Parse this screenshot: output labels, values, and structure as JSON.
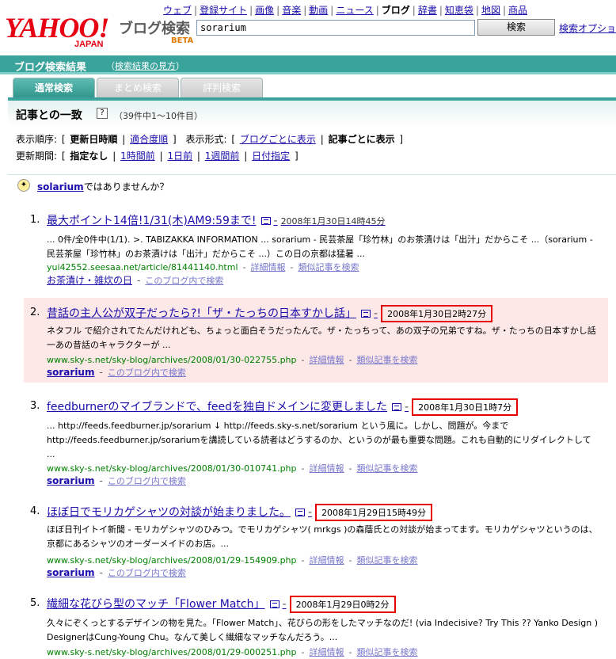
{
  "nav": {
    "items": [
      "ウェブ",
      "登録サイト",
      "画像",
      "音楽",
      "動画",
      "ニュース",
      "ブログ",
      "辞書",
      "知恵袋",
      "地図",
      "商品"
    ],
    "current": "ブログ"
  },
  "header": {
    "logo_main": "YAHOO!",
    "logo_sub": "JAPAN",
    "service": "ブログ検索",
    "beta": "BETA",
    "search_value": "sorarium",
    "search_button": "検索",
    "search_options": "検索オプション"
  },
  "result_bar": {
    "title": "ブログ検索結果",
    "help": "（検索結果の見方）",
    "help_link": "検索結果の見方"
  },
  "tabs": [
    {
      "label": "通常検索",
      "active": true
    },
    {
      "label": "まとめ検索",
      "active": false
    },
    {
      "label": "評判検索",
      "active": false
    }
  ],
  "section": {
    "title": "記事との一致",
    "help_icon": "?",
    "count": "（39件中1～10件目）"
  },
  "sort": {
    "label": "表示順序:",
    "open": "[",
    "option1": "更新日時順",
    "option2": "適合度順",
    "close": "]",
    "display_label": "表示形式:",
    "display1": "ブログごとに表示",
    "display2": "記事ごとに表示"
  },
  "period": {
    "label": "更新期間:",
    "open": "[",
    "opt0": "指定なし",
    "opt1": "1時間前",
    "opt2": "1日前",
    "opt3": "1週間前",
    "opt4": "日付指定",
    "close": "]"
  },
  "suggest": {
    "word": "solarium",
    "text": "ではありませんか？"
  },
  "results": [
    {
      "num": "1.",
      "title": "最大ポイント14倍!1/31(木)AM9:59まで!",
      "date": "2008年1月30日14時45分",
      "date_boxed": false,
      "snippet": "... 0件/全0件中(1/1). >. TABIZAKKA INFORMATION ... sorarium - 民芸茶屋「珍竹林」のお茶漬けは「出汁」だからこそ ...（sorarium - 民芸茶屋「珍竹林」のお茶漬けは「出汁」だからこそ ...）この日の京都は猛暑 ...",
      "url": "yui42552.seesaa.net/article/81441140.html",
      "detail": "詳細情報",
      "similar": "類似記事を検索",
      "blog": "お茶漬け・雑炊の日",
      "blog_search": "このブログ内で検索"
    },
    {
      "num": "2.",
      "title": "昔話の主人公が双子だったら?!「ザ・たっちの日本すかし話」",
      "date": "2008年1月30日2時27分",
      "date_boxed": true,
      "snippet": "ネタフル で紹介されてたんだけれども、ちょっと面白そうだったんで。ザ・たっちって、あの双子の兄弟ですね。ザ・たっちの日本すかし話一あの昔話のキャラクターが ...",
      "url": "www.sky-s.net/sky-blog/archives/2008/01/30-022755.php",
      "detail": "詳細情報",
      "similar": "類似記事を検索",
      "blog": "sorarium",
      "blog_search": "このブログ内で検索"
    },
    {
      "num": "3.",
      "title": "feedburnerのマイブランドで、feedを独自ドメインに変更しました",
      "date": "2008年1月30日1時7分",
      "date_boxed": true,
      "snippet": "... http://feeds.feedburner.jp/sorarium ↓ http://feeds.sky-s.net/sorarium という風に。しかし、問題が。今まで http://feeds.feedburner.jp/sorariumを講読している読者はどうするのか、というのが最も重要な問題。これも自動的にリダイレクトして ...",
      "url": "www.sky-s.net/sky-blog/archives/2008/01/30-010741.php",
      "detail": "詳細情報",
      "similar": "類似記事を検索",
      "blog": "sorarium",
      "blog_search": "このブログ内で検索"
    },
    {
      "num": "4.",
      "title": "ほぼ日でモリカゲシャツの対談が始まりました。",
      "date": "2008年1月29日15時49分",
      "date_boxed": true,
      "snippet": "ほぼ日刊イトイ新聞 - モリカゲシャツのひみつ。でモリカゲシャツ( mrkgs )の森蔭氏との対談が始まってます。モリカゲシャツというのは、京都にあるシャツのオーダーメイドのお店。...",
      "url": "www.sky-s.net/sky-blog/archives/2008/01/29-154909.php",
      "detail": "詳細情報",
      "similar": "類似記事を検索",
      "blog": "sorarium",
      "blog_search": "このブログ内で検索"
    },
    {
      "num": "5.",
      "title": "繊細な花びら型のマッチ「Flower Match」",
      "date": "2008年1月29日0時2分",
      "date_boxed": true,
      "snippet": "久々にぞくっとするデザインの物を見た。「Flower Match」、花びらの形をしたマッチなのだ! (via Indecisive? Try This ?? Yanko Design ) DesignerはCung-Young Chu。なんて美しく繊細なマッチなんだろう。...",
      "url": "www.sky-s.net/sky-blog/archives/2008/01/29-000251.php",
      "detail": "詳細情報",
      "similar": "類似記事を検索"
    }
  ]
}
